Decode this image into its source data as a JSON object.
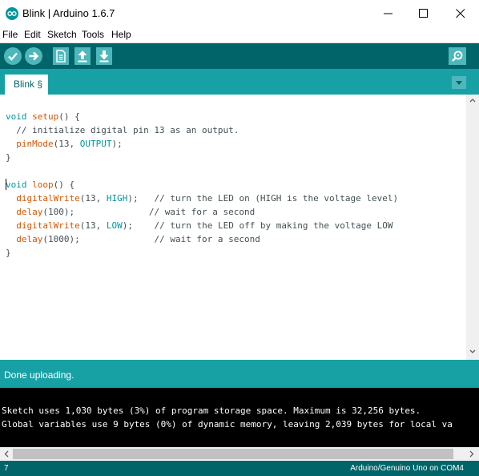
{
  "window": {
    "title": "Blink | Arduino 1.6.7"
  },
  "menu": [
    "File",
    "Edit",
    "Sketch",
    "Tools",
    "Help"
  ],
  "tab": {
    "label": "Blink §"
  },
  "code": [
    [
      {
        "t": "void",
        "c": "kw"
      },
      {
        "t": " "
      },
      {
        "t": "setup",
        "c": "fn"
      },
      {
        "t": "() {"
      }
    ],
    [
      {
        "t": "  // initialize digital pin 13 as an output.",
        "c": "cmt"
      }
    ],
    [
      {
        "t": "  "
      },
      {
        "t": "pinMode",
        "c": "fn"
      },
      {
        "t": "(13, "
      },
      {
        "t": "OUTPUT",
        "c": "cst"
      },
      {
        "t": ");"
      }
    ],
    [
      {
        "t": "}"
      }
    ],
    [
      {
        "t": ""
      }
    ],
    [
      {
        "t": "void",
        "c": "kw"
      },
      {
        "t": " "
      },
      {
        "t": "loop",
        "c": "fn"
      },
      {
        "t": "() {"
      }
    ],
    [
      {
        "t": "  "
      },
      {
        "t": "digitalWrite",
        "c": "fn"
      },
      {
        "t": "(13, "
      },
      {
        "t": "HIGH",
        "c": "cst"
      },
      {
        "t": ");   "
      },
      {
        "t": "// turn the LED on (HIGH is the voltage level)",
        "c": "cmt"
      }
    ],
    [
      {
        "t": "  "
      },
      {
        "t": "delay",
        "c": "fn"
      },
      {
        "t": "(100);              "
      },
      {
        "t": "// wait for a second",
        "c": "cmt"
      }
    ],
    [
      {
        "t": "  "
      },
      {
        "t": "digitalWrite",
        "c": "fn"
      },
      {
        "t": "(13, "
      },
      {
        "t": "LOW",
        "c": "cst"
      },
      {
        "t": ");    "
      },
      {
        "t": "// turn the LED off by making the voltage LOW",
        "c": "cmt"
      }
    ],
    [
      {
        "t": "  "
      },
      {
        "t": "delay",
        "c": "fn"
      },
      {
        "t": "(1000);              "
      },
      {
        "t": "// wait for a second",
        "c": "cmt"
      }
    ],
    [
      {
        "t": "}"
      }
    ]
  ],
  "status": {
    "text": "Done uploading."
  },
  "console": [
    "Sketch uses 1,030 bytes (3%) of program storage space. Maximum is 32,256 bytes.",
    "Global variables use 9 bytes (0%) of dynamic memory, leaving 2,039 bytes for local va"
  ],
  "footer": {
    "line": "7",
    "board": "Arduino/Genuino Uno on COM4"
  },
  "icons": {
    "verify": "checkmark-icon",
    "upload": "arrow-right-icon",
    "new": "new-file-icon",
    "open": "open-arrow-up-icon",
    "save": "save-arrow-down-icon",
    "serial": "magnifier-icon",
    "tab_menu": "triangle-down-icon"
  },
  "colors": {
    "toolbar": "#006468",
    "tabbar": "#17a1a5",
    "button": "#4db7bb",
    "keyword": "#00979c",
    "function": "#d35400",
    "console_bg": "#000000"
  }
}
